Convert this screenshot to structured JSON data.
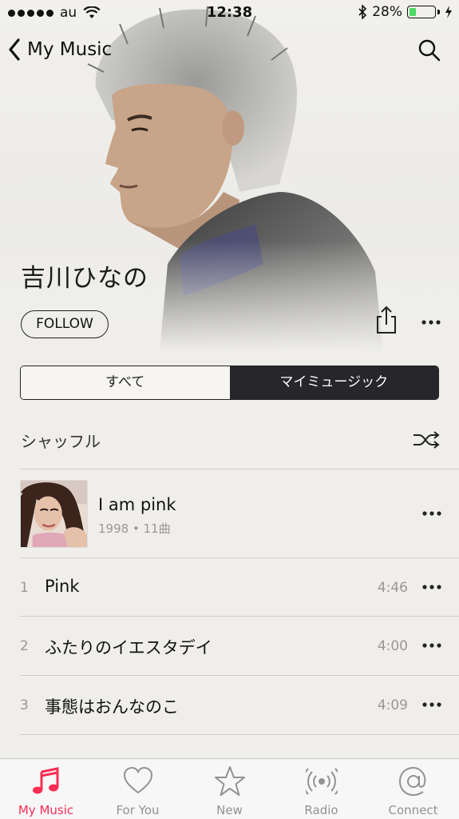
{
  "status_bar": {
    "carrier": "au",
    "time": "12:38",
    "battery": "28%",
    "battery_level": 0.28
  },
  "nav": {
    "back_label": "My Music"
  },
  "artist": {
    "name": "吉川ひなの",
    "follow_label": "FOLLOW"
  },
  "segmented": {
    "all_label": "すべて",
    "my_music_label": "マイミュージック",
    "selected": "my_music"
  },
  "shuffle_label": "シャッフル",
  "album": {
    "title": "I am pink",
    "meta": "1998 • 11曲"
  },
  "tracks": [
    {
      "number": "1",
      "title": "Pink",
      "duration": "4:46"
    },
    {
      "number": "2",
      "title": "ふたりのイエスタデイ",
      "duration": "4:00"
    },
    {
      "number": "3",
      "title": "事態はおんなのこ",
      "duration": "4:09"
    }
  ],
  "tabs": [
    {
      "label": "My Music",
      "icon": "music-note-icon",
      "active": true
    },
    {
      "label": "For You",
      "icon": "heart-icon",
      "active": false
    },
    {
      "label": "New",
      "icon": "star-icon",
      "active": false
    },
    {
      "label": "Radio",
      "icon": "radio-icon",
      "active": false
    },
    {
      "label": "Connect",
      "icon": "at-icon",
      "active": false
    }
  ],
  "colors": {
    "accent": "#fa2d55",
    "segment_selected": "#26262b",
    "battery": "#4cd964"
  }
}
